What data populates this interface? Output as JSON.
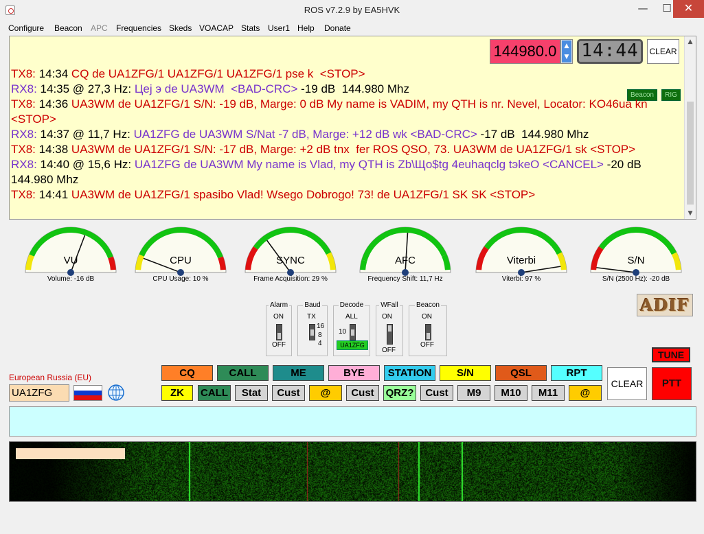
{
  "window": {
    "title": "ROS v7.2.9 by EA5HVK",
    "minimize": "—",
    "maximize": "☐",
    "close": "✕"
  },
  "menu": [
    "Configure",
    "Beacon",
    "APC",
    "Frequencies",
    "Skeds",
    "VOACAP",
    "Stats",
    "User1",
    "Help",
    "Donate"
  ],
  "log": {
    "frequency": "144980.0",
    "clock": "14:44",
    "clear_label": "CLEAR",
    "beacon_tag": "Beacon",
    "rig_tag": "RIG",
    "lines": [
      {
        "kind": "tx",
        "tag": "TX8:",
        "time": "14:34",
        "text": "CQ de UA1ZFG/1 UA1ZFG/1 UA1ZFG/1 pse k  <STOP>",
        "tail": ""
      },
      {
        "kind": "rx",
        "tag": "RX8:",
        "time": "14:35 @ 27,3 Hz:",
        "text": "Цеј э de UA3WM  <BAD-CRC>",
        "tail": " -19 dB  144.980 Mhz"
      },
      {
        "kind": "tx",
        "tag": "TX8:",
        "time": "14:36",
        "text": "UA3WM de UA1ZFG/1 S/N: -19 dB, Marge: 0 dB My name is VADIM, my QTH is nr. Nevel, Locator: KO46ua kn <STOP>",
        "tail": ""
      },
      {
        "kind": "rx",
        "tag": "RX8:",
        "time": "14:37 @ 11,7 Hz:",
        "text": "UA1ZFG de UA3WM S/Nat -7 dB, Marge: +12 dB wk <BAD-CRC>",
        "tail": " -17 dB  144.980 Mhz"
      },
      {
        "kind": "tx",
        "tag": "TX8:",
        "time": "14:38",
        "text": "UA3WM de UA1ZFG/1 S/N: -17 dB, Marge: +2 dB tnx  fer ROS QSO, 73. UA3WM de UA1ZFG/1 sk <STOP>",
        "tail": ""
      },
      {
        "kind": "rx",
        "tag": "RX8:",
        "time": "14:40 @ 15,6 Hz:",
        "text": "UA1ZFG de UA3WM My name is Vlad, my QTH is Zb\\Що$tg 4euhaqclg tэkeO <CANCEL>",
        "tail": " -20 dB  144.980 Mhz"
      },
      {
        "kind": "tx",
        "tag": "TX8:",
        "time": "14:41",
        "text": "UA3WM de UA1ZFG/1 spasibo Vlad! Wsego Dobrogo! 73! de UA1ZFG/1 SK SK <STOP>",
        "tail": ""
      }
    ]
  },
  "gauges": [
    {
      "title": "VU",
      "caption": "Volume: -16 dB",
      "level": 0.62,
      "zones": "gyr"
    },
    {
      "title": "CPU",
      "caption": "CPU Usage: 10 %",
      "level": 0.1,
      "zones": "gyr"
    },
    {
      "title": "SYNC",
      "caption": "Frame Acquisition: 29 %",
      "level": 0.29,
      "zones": "ryg"
    },
    {
      "title": "AFC",
      "caption": "Frequency Shift: 11,7 Hz",
      "level": 0.52,
      "zones": "ggg"
    },
    {
      "title": "Viterbi",
      "caption": "Viterbi: 97 %",
      "level": 0.97,
      "zones": "ryg"
    },
    {
      "title": "S/N",
      "caption": "S/N (2500 Hz): -20 dB",
      "level": 0.02,
      "zones": "ryg"
    }
  ],
  "switches": {
    "alarm": {
      "title": "Alarm",
      "on": "ON",
      "off": "OFF"
    },
    "baud": {
      "title": "Baud",
      "tx": "TX",
      "v16": "16",
      "v8": "8",
      "v4": "4"
    },
    "decode": {
      "title": "Decode",
      "all": "ALL",
      "v10": "10",
      "call": "UA1ZFG"
    },
    "wfall": {
      "title": "WFall",
      "on": "ON",
      "off": "OFF"
    },
    "beacon": {
      "title": "Beacon",
      "on": "ON",
      "off": "OFF"
    }
  },
  "adif_label": "ADIF",
  "tune_label": "TUNE",
  "ptt_label": "PTT",
  "clear_label": "CLEAR",
  "station": {
    "region": "European Russia (EU)",
    "callsign": "UA1ZFG"
  },
  "macros_row1": [
    {
      "label": "CQ",
      "color": "#ff7f27"
    },
    {
      "label": "CALL",
      "color": "#2e8b57"
    },
    {
      "label": "ME",
      "color": "#1e8c8c"
    },
    {
      "label": "BYE",
      "color": "#ffaed7"
    },
    {
      "label": "STATION",
      "color": "#33ccee"
    },
    {
      "label": "S/N",
      "color": "#ffff00"
    },
    {
      "label": "QSL",
      "color": "#e05a1a"
    },
    {
      "label": "RPT",
      "color": "#55ffff"
    }
  ],
  "macros_row2": [
    {
      "label": "ZK",
      "color": "#ffff00"
    },
    {
      "label": "CALL",
      "color": "#2e8b57"
    },
    {
      "label": "Stat",
      "color": "#d4d4d4"
    },
    {
      "label": "Cust",
      "color": "#d4d4d4"
    },
    {
      "label": "@",
      "color": "#ffcc00"
    },
    {
      "label": "Cust",
      "color": "#d4d4d4"
    },
    {
      "label": "QRZ?",
      "color": "#99ff99"
    },
    {
      "label": "Cust",
      "color": "#d4d4d4"
    },
    {
      "label": "M9",
      "color": "#d4d4d4"
    },
    {
      "label": "M10",
      "color": "#d4d4d4"
    },
    {
      "label": "M11",
      "color": "#d4d4d4"
    },
    {
      "label": "@",
      "color": "#ffcc00"
    }
  ],
  "tx_input": {
    "value": ""
  }
}
